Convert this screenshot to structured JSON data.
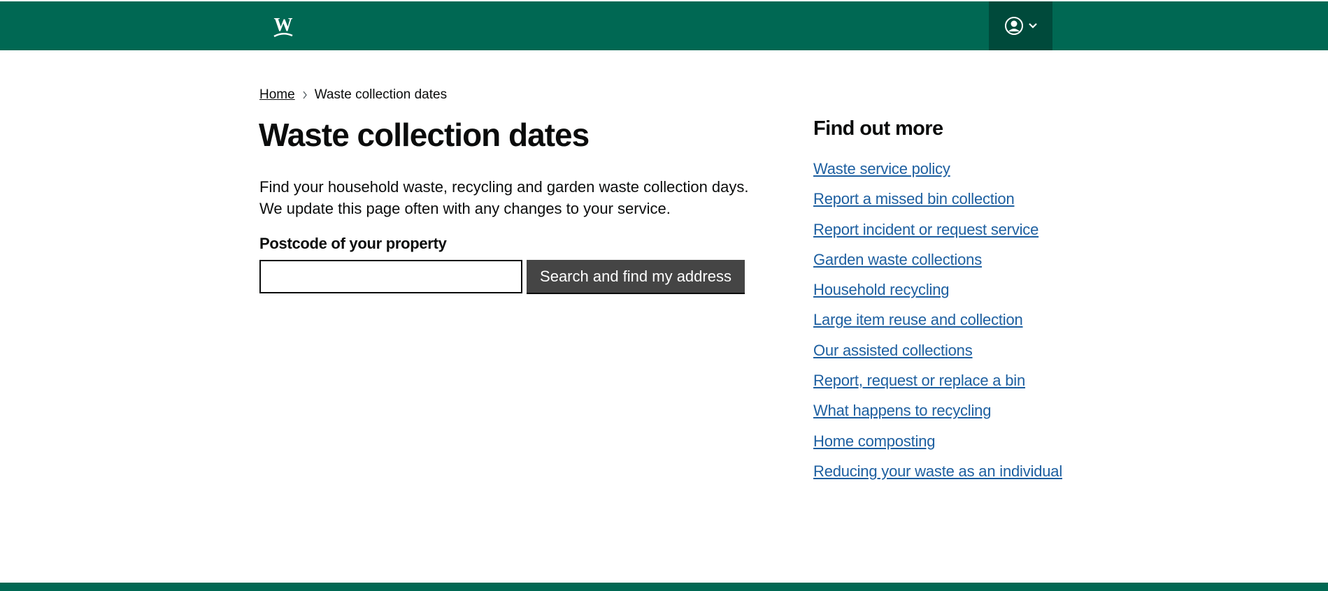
{
  "brand": {
    "primary_color": "#006853",
    "dark_color": "#004a3b",
    "link_color": "#1d5fa0",
    "logo_icon": "w-logo-icon",
    "logo_letter": "W"
  },
  "header": {
    "account_icon": "user-circle-icon",
    "account_chevron_icon": "chevron-down-icon"
  },
  "breadcrumb": {
    "home": "Home",
    "current": "Waste collection dates"
  },
  "main": {
    "title": "Waste collection dates",
    "intro": "Find your household waste, recycling and garden waste collection days. We update this page often with any changes to your service.",
    "postcode_label": "Postcode of your property",
    "postcode_value": "",
    "search_button": "Search and find my address"
  },
  "sidebar": {
    "title": "Find out more",
    "links": [
      "Waste service policy",
      "Report a missed bin collection",
      "Report incident or request service",
      "Garden waste collections",
      "Household recycling",
      "Large item reuse and collection",
      "Our assisted collections",
      "Report, request or replace a bin",
      "What happens to recycling",
      "Home composting",
      "Reducing your waste as an individual"
    ]
  }
}
